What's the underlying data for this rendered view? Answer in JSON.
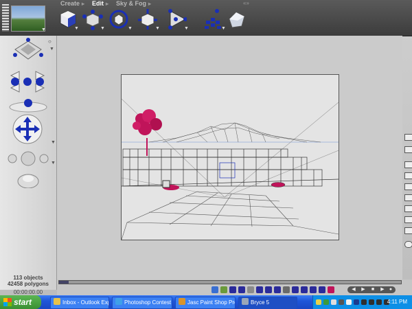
{
  "menu": {
    "tabs": [
      {
        "label": "Create",
        "active": false
      },
      {
        "label": "Edit",
        "active": true
      },
      {
        "label": "Sky & Fog",
        "active": false
      }
    ]
  },
  "toolbar": {
    "tools": [
      "cube-tool",
      "resize-tool",
      "rotate-tool",
      "reposition-tool",
      "align-tool",
      "randomize-tool",
      "materials-tool"
    ]
  },
  "status": {
    "objects": "113 objects",
    "polygons": "42458 polygons",
    "time": "00:00:00.00"
  },
  "taskbar": {
    "start_label": "start",
    "tasks": [
      {
        "label": "Inbox - Outlook Express",
        "icon": "outlook-icon",
        "color": "#e8c24a"
      },
      {
        "label": "Photoshop Contest O...",
        "icon": "ie-icon",
        "color": "#3fa0e8"
      },
      {
        "label": "Jasc Paint Shop Pro - ...",
        "icon": "psp-icon",
        "color": "#d9942a"
      },
      {
        "label": "Bryce 5",
        "icon": "bryce-icon",
        "color": "#9aa6b8"
      }
    ],
    "clock": "4:11 PM"
  },
  "colors": {
    "accent_blue": "#1a2fb5",
    "tree_magenta": "#c0145a",
    "taskbar_blue": "#2458d8"
  }
}
